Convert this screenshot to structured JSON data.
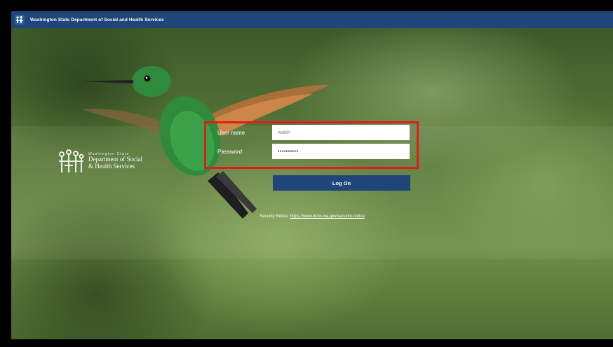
{
  "header": {
    "title": "Washington State Department of Social and Health Services"
  },
  "logo": {
    "state": "Washington State",
    "dept_line1": "Department of Social",
    "dept_line2": "& Health Services"
  },
  "login": {
    "username_label": "User name",
    "username_value": "walsh",
    "password_label": "Password",
    "password_value": "••••••••••",
    "logon_label": "Log On"
  },
  "security": {
    "label": "Security Notice:",
    "link": "https://www.dshs.wa.gov/security-notice"
  },
  "colors": {
    "header": "#1f4579",
    "button": "#1f4579",
    "highlight": "#e01b1b"
  },
  "icons": {
    "header_logo": "dshs-logo-icon",
    "brand_logo": "dshs-family-icon",
    "background": "hummingbird"
  }
}
